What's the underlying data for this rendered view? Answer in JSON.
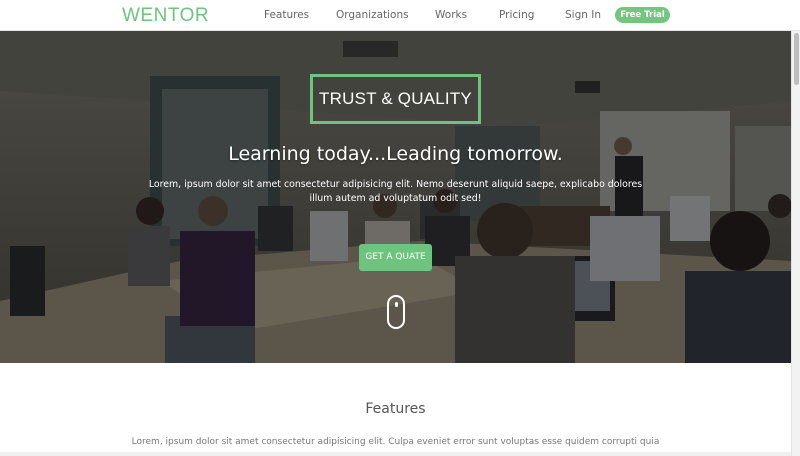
{
  "brand": {
    "name": "WENTOR",
    "color": "#6cc47e"
  },
  "nav": {
    "links": [
      "Features",
      "Organizations",
      "Works",
      "Pricing",
      "Sign In"
    ],
    "cta_label": "Free Trial"
  },
  "hero": {
    "badge": "TRUST & QUALITY",
    "headline": "Learning today...Leading tomorrow.",
    "subtext": "Lorem, ipsum dolor sit amet consectetur adipisicing elit. Nemo deserunt aliquid saepe, explicabo dolores illum autem ad voluptatum odit sed!",
    "cta_label": "GET A QUATE",
    "scroll_indicator_icon": "mouse-scroll-icon",
    "background_image": "classroom-photo"
  },
  "features": {
    "title": "Features",
    "text": "Lorem, ipsum dolor sit amet consectetur adipisicing elit. Culpa eveniet error sunt voluptas esse quidem corrupti quia"
  }
}
